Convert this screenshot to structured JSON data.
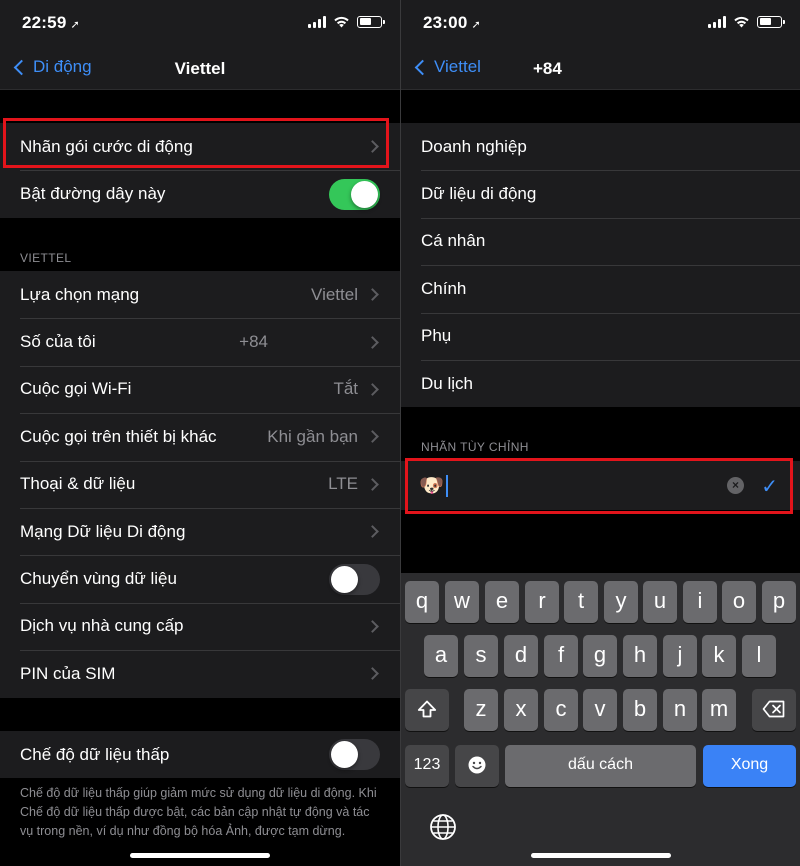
{
  "left": {
    "status_time": "22:59",
    "nav": {
      "back": "Di động",
      "title": "Viettel"
    },
    "rows_top": [
      {
        "label": "Nhãn gói cước di động",
        "value": ""
      },
      {
        "label": "Bật đường dây này"
      }
    ],
    "section_title": "VIETTEL",
    "rows": [
      {
        "label": "Lựa chọn mạng",
        "value": "Viettel"
      },
      {
        "label": "Số của tôi",
        "value": "+84"
      },
      {
        "label": "Cuộc gọi Wi-Fi",
        "value": "Tắt"
      },
      {
        "label": "Cuộc gọi trên thiết bị khác",
        "value": "Khi gần bạn"
      },
      {
        "label": "Thoại & dữ liệu",
        "value": "LTE"
      },
      {
        "label": "Mạng Dữ liệu Di động",
        "value": ""
      },
      {
        "label": "Chuyển vùng dữ liệu"
      },
      {
        "label": "Dịch vụ nhà cung cấp",
        "value": ""
      },
      {
        "label": "PIN của SIM",
        "value": ""
      }
    ],
    "low_data": {
      "label": "Chế độ dữ liệu thấp"
    },
    "footnote": "Chế độ dữ liệu thấp giúp giảm mức sử dụng dữ liệu di động. Khi Chế độ dữ liệu thấp được bật, các bản cập nhật tự động và tác vụ trong nền, ví dụ như đồng bộ hóa Ảnh, được tạm dừng.",
    "toggles": {
      "line_enabled": true,
      "roaming": false,
      "low_data": false
    }
  },
  "right": {
    "status_time": "23:00",
    "nav": {
      "back": "Viettel",
      "title": "+84"
    },
    "options": [
      "Doanh nghiệp",
      "Dữ liệu di động",
      "Cá nhân",
      "Chính",
      "Phụ",
      "Du lịch"
    ],
    "custom_section_title": "NHÃN TÙY CHỈNH",
    "custom_value": "🐶",
    "keyboard": {
      "row1": [
        "q",
        "w",
        "e",
        "r",
        "t",
        "y",
        "u",
        "i",
        "o",
        "p"
      ],
      "row2": [
        "a",
        "s",
        "d",
        "f",
        "g",
        "h",
        "j",
        "k",
        "l"
      ],
      "row3": [
        "z",
        "x",
        "c",
        "v",
        "b",
        "n",
        "m"
      ],
      "numbers": "123",
      "space": "dấu cách",
      "done": "Xong"
    }
  },
  "colors": {
    "accent": "#3e8ef7",
    "highlight": "#e3141b",
    "toggle_on": "#34c759"
  }
}
